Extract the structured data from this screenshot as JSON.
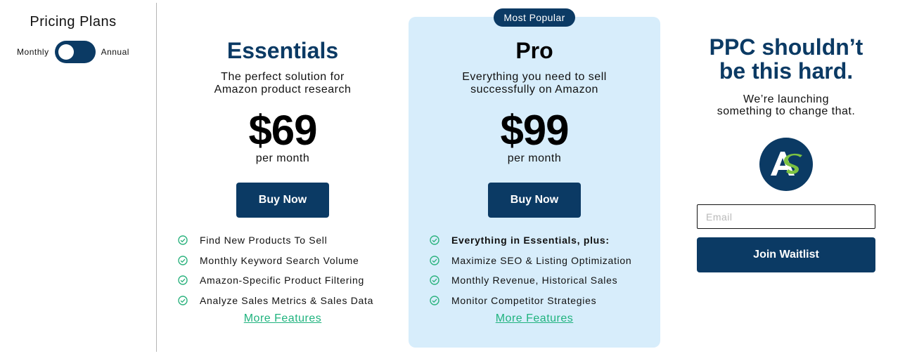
{
  "sidebar": {
    "title": "Pricing Plans",
    "toggle": {
      "left_label": "Monthly",
      "right_label": "Annual",
      "selected": "Monthly"
    }
  },
  "plans": [
    {
      "name": "Essentials",
      "description_lines": [
        "The perfect solution for",
        "Amazon product research"
      ],
      "price": "$69",
      "period": "per month",
      "button_label": "Buy Now",
      "features": [
        {
          "text": "Find New Products To Sell",
          "bold": false
        },
        {
          "text": "Monthly Keyword Search Volume",
          "bold": false
        },
        {
          "text": "Amazon-Specific Product Filtering",
          "bold": false
        },
        {
          "text": "Analyze Sales Metrics & Sales Data",
          "bold": false
        }
      ],
      "more_link": "More Features"
    },
    {
      "name": "Pro",
      "badge": "Most Popular",
      "description_lines": [
        "Everything you need to sell",
        "successfully on Amazon"
      ],
      "price": "$99",
      "period": "per month",
      "button_label": "Buy Now",
      "features": [
        {
          "text": "Everything in Essentials, plus:",
          "bold": true
        },
        {
          "text": "Maximize SEO & Listing Optimization",
          "bold": false
        },
        {
          "text": "Monthly Revenue, Historical Sales",
          "bold": false
        },
        {
          "text": "Monitor Competitor Strategies",
          "bold": false
        }
      ],
      "more_link": "More Features"
    }
  ],
  "waitlist": {
    "headline_lines": [
      "PPC shouldn’t",
      "be this hard."
    ],
    "subtext_lines": [
      "We’re launching",
      "something to change that."
    ],
    "logo_icon": "as-logo-icon",
    "email_placeholder": "Email",
    "email_value": "",
    "button_label": "Join Waitlist"
  },
  "colors": {
    "brand_navy": "#0b3a64",
    "pro_card_bg": "#d7edfb",
    "accent_green": "#1fb37e",
    "check_green": "#2db37f"
  },
  "icons": {
    "feature_check": "check-circle-icon"
  }
}
